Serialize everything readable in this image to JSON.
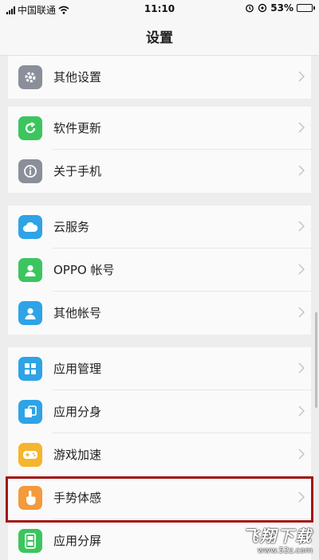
{
  "status_bar": {
    "carrier": "中国联通",
    "time": "11:10",
    "battery": "53%",
    "battery_level": 0.53,
    "icons": [
      "signal-icon",
      "wifi-icon",
      "alarm-icon",
      "sync-icon",
      "battery-icon"
    ]
  },
  "header": {
    "title": "设置"
  },
  "groups": [
    {
      "items": [
        {
          "label": "其他设置",
          "icon": "gear-icon",
          "color": "#8a8f99"
        }
      ]
    },
    {
      "items": [
        {
          "label": "软件更新",
          "icon": "update-icon",
          "color": "#3cc55f"
        },
        {
          "label": "关于手机",
          "icon": "info-icon",
          "color": "#8a8f99"
        }
      ]
    },
    {
      "items": [
        {
          "label": "云服务",
          "icon": "cloud-icon",
          "color": "#2ea3e6"
        },
        {
          "label": "OPPO 帐号",
          "icon": "user-icon",
          "color": "#3cc55f"
        },
        {
          "label": "其他帐号",
          "icon": "user-icon",
          "color": "#2ea3e6"
        }
      ]
    },
    {
      "items": [
        {
          "label": "应用管理",
          "icon": "apps-grid-icon",
          "color": "#2ea3e6"
        },
        {
          "label": "应用分身",
          "icon": "app-clone-icon",
          "color": "#2ea3e6"
        },
        {
          "label": "游戏加速",
          "icon": "gamepad-icon",
          "color": "#f5b52e"
        },
        {
          "label": "手势体感",
          "icon": "gesture-hand-icon",
          "color": "#f39a3c"
        },
        {
          "label": "应用分屏",
          "icon": "split-screen-icon",
          "color": "#3cc55f"
        }
      ]
    }
  ],
  "highlight": {
    "item": "手势体感",
    "color": "#a31212"
  },
  "watermark": {
    "title": "飞翔下载",
    "url": "www.52z.com"
  }
}
